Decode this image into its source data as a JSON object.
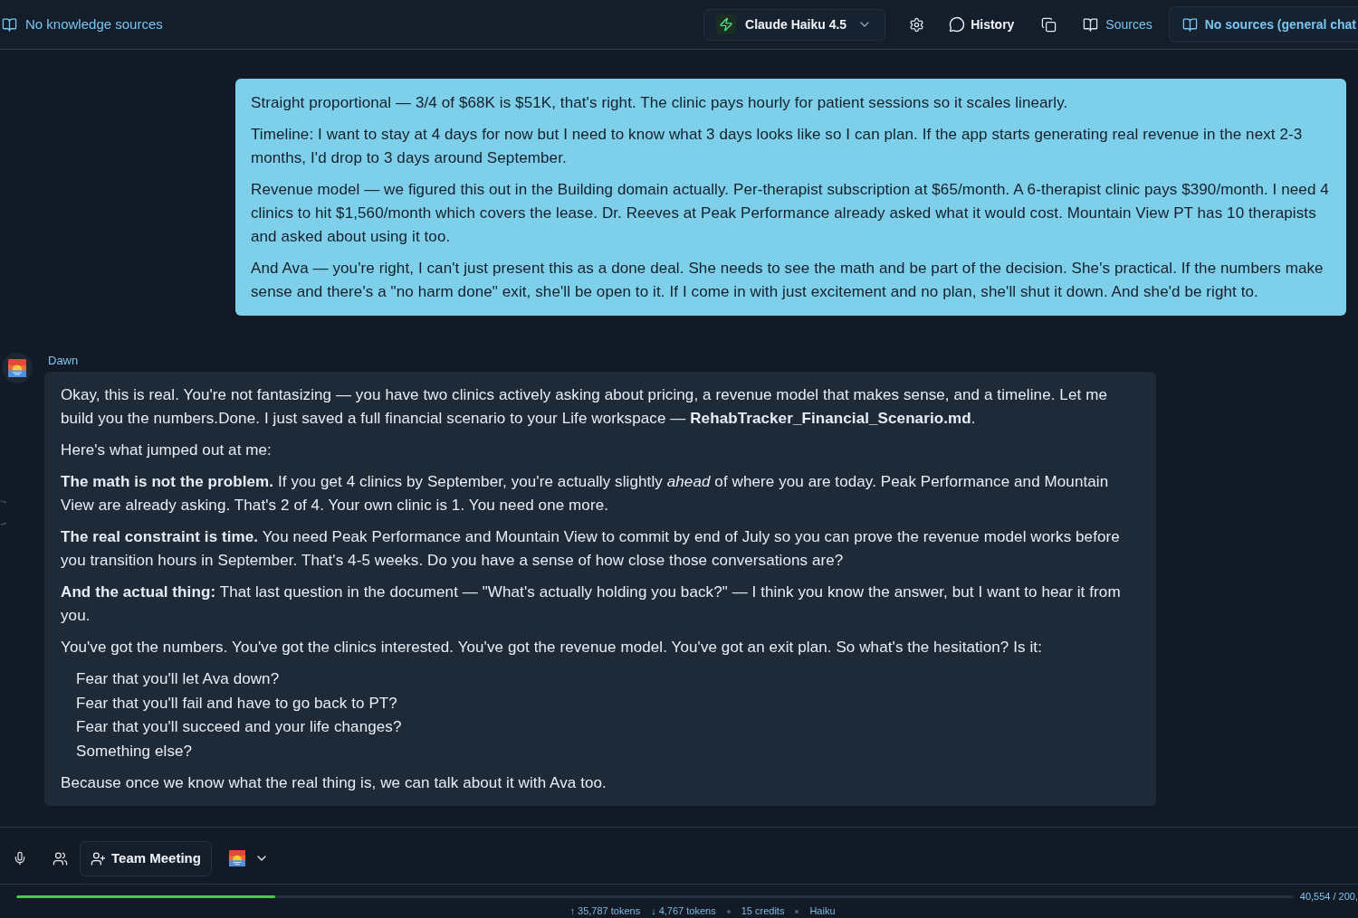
{
  "top_bar": {
    "knowledge_label": "No knowledge sources",
    "model_selector": "Claude Haiku 4.5",
    "history_button": "History",
    "sources_button": "Sources",
    "source_scope": "No sources (general chat"
  },
  "conversation": [
    {
      "kind": "user",
      "blocks": [
        {
          "kind": "paragraph",
          "text": "Straight proportional — 3/4 of $68K is $51K, that's right. The clinic pays hourly for patient sessions so it scales linearly."
        },
        {
          "kind": "paragraph",
          "text": "Timeline: I want to stay at 4 days for now but I need to know what 3 days looks like so I can plan. If the app starts generating real revenue in the next 2-3 months, I'd drop to 3 days around September."
        },
        {
          "kind": "paragraph",
          "text": "Revenue model — we figured this out in the Building domain actually. Per-therapist subscription at $65/month. A 6-therapist clinic pays $390/month. I need 4 clinics to hit $1,560/month which covers the lease. Dr. Reeves at Peak Performance already asked what it would cost. Mountain View PT has 10 therapists and asked about using it too."
        },
        {
          "kind": "paragraph",
          "text": "And Ava — you're right, I can't just present this as a done deal. She needs to see the math and be part of the decision. She's practical. If the numbers make sense and there's a \"no harm done\" exit, she'll be open to it. If I come in with just excitement and no plan, she'll shut it down. And she'd be right to."
        }
      ]
    },
    {
      "kind": "assistant",
      "sender": "Dawn",
      "blocks": [
        {
          "kind": "paragraph",
          "text": "Okay, this is real. You're not fantasizing — you have two clinics actively asking about pricing, a revenue model that makes sense, and a timeline. Let me build you the numbers.Done. I just saved a full financial scenario to your Life workspace — **RehabTracker_Financial_Scenario.md**."
        },
        {
          "kind": "paragraph",
          "text": "Here's what jumped out at me:"
        },
        {
          "kind": "paragraph",
          "text": "**The math is not the problem.** If you get 4 clinics by September, you're actually slightly *ahead* of where you are today. Peak Performance and Mountain View are already asking. That's 2 of 4. Your own clinic is 1. You need one more."
        },
        {
          "kind": "paragraph",
          "text": "**The real constraint is time.** You need Peak Performance and Mountain View to commit by end of July so you can prove the revenue model works before you transition hours in September. That's 4-5 weeks. Do you have a sense of how close those conversations are?"
        },
        {
          "kind": "paragraph",
          "text": "**And the actual thing:** That last question in the document — \"What's actually holding you back?\" — I think you know the answer, but I want to hear it from you."
        },
        {
          "kind": "paragraph",
          "text": "You've got the numbers. You've got the clinics interested. You've got the revenue model. You've got an exit plan. So what's the hesitation? Is it:"
        },
        {
          "kind": "list",
          "items": [
            "Fear that you'll let Ava down?",
            "Fear that you'll fail and have to go back to PT?",
            "Fear that you'll succeed and your life changes?",
            "Something else?"
          ]
        },
        {
          "kind": "paragraph",
          "text": "Because once we know what the real thing is, we can talk about it with Ava too."
        }
      ]
    }
  ],
  "composer": {
    "team_meeting_button": "Team Meeting"
  },
  "usage": {
    "level": 0.203,
    "reading": "40,554 / 200,",
    "stats": [
      {
        "text": "↑ 35,787 tokens",
        "dot_before": false
      },
      {
        "text": "↓ 4,767 tokens",
        "dot_before": false
      },
      {
        "text": "15 credits",
        "dot_before": true
      },
      {
        "text": "Haiku",
        "dot_before": true
      }
    ]
  }
}
